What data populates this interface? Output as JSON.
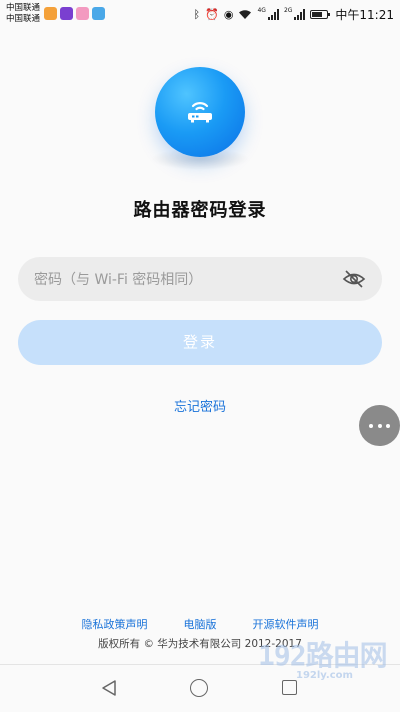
{
  "status_bar": {
    "carriers": [
      "中国联通",
      "中国联通"
    ],
    "network_badges": [
      "4G",
      "2G"
    ],
    "time": "中午11:21"
  },
  "app": {
    "title": "路由器密码登录",
    "password_placeholder": "密码（与 Wi-Fi 密码相同）",
    "login_label": "登录",
    "forgot_label": "忘记密码"
  },
  "footer": {
    "links": [
      "隐私政策声明",
      "电脑版",
      "开源软件声明"
    ],
    "copyright": "版权所有 © 华为技术有限公司 2012-2017"
  },
  "watermark": {
    "main": "192路由网",
    "sub": "192ly.com"
  },
  "colors": {
    "accent": "#1a73d9",
    "logo_blue": "#1a9bf5",
    "login_disabled": "#c6e0fb"
  }
}
